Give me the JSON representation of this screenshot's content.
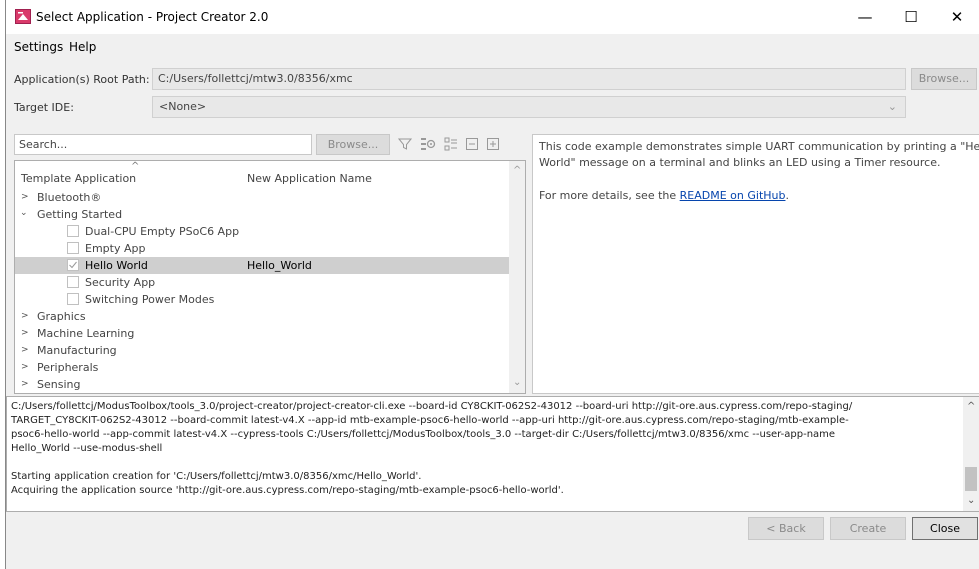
{
  "window": {
    "title": "Select Application - Project Creator 2.0"
  },
  "window_controls": {
    "minimize": "—",
    "maximize": "☐",
    "close": "✕"
  },
  "menu": {
    "settings": "Settings",
    "help": "Help"
  },
  "root_path": {
    "label": "Application(s) Root Path:",
    "value": "C:/Users/follettcj/mtw3.0/8356/xmc",
    "browse": "Browse..."
  },
  "target_ide": {
    "label": "Target IDE:",
    "value": "<None>"
  },
  "search": {
    "placeholder": "Search...",
    "browse": "Browse..."
  },
  "tree": {
    "col_template": "Template Application",
    "col_name": "New Application Name",
    "items": [
      {
        "label": "Bluetooth®",
        "name": ""
      },
      {
        "label": "Getting Started",
        "name": ""
      },
      {
        "label": "Dual-CPU Empty PSoC6 App",
        "name": ""
      },
      {
        "label": "Empty App",
        "name": ""
      },
      {
        "label": "Hello World",
        "name": "Hello_World"
      },
      {
        "label": "Security App",
        "name": ""
      },
      {
        "label": "Switching Power Modes",
        "name": ""
      },
      {
        "label": "Graphics",
        "name": ""
      },
      {
        "label": "Machine Learning",
        "name": ""
      },
      {
        "label": "Manufacturing",
        "name": ""
      },
      {
        "label": "Peripherals",
        "name": ""
      },
      {
        "label": "Sensing",
        "name": ""
      }
    ]
  },
  "description": {
    "line1": "This code example demonstrates simple UART communication by printing a \"Hello",
    "line2": "World\" message on a terminal and blinks an LED using a Timer resource.",
    "details_prefix": "For more details, see the ",
    "details_link": "README on GitHub",
    "details_suffix": "."
  },
  "console": {
    "lines": [
      "C:/Users/follettcj/ModusToolbox/tools_3.0/project-creator/project-creator-cli.exe --board-id CY8CKIT-062S2-43012 --board-uri http://git-ore.aus.cypress.com/repo-staging/",
      "TARGET_CY8CKIT-062S2-43012 --board-commit latest-v4.X --app-id mtb-example-psoc6-hello-world --app-uri http://git-ore.aus.cypress.com/repo-staging/mtb-example-",
      "psoc6-hello-world --app-commit latest-v4.X --cypress-tools C:/Users/follettcj/ModusToolbox/tools_3.0 --target-dir C:/Users/follettcj/mtw3.0/8356/xmc --user-app-name",
      "Hello_World --use-modus-shell",
      "",
      "Starting application creation for 'C:/Users/follettcj/mtw3.0/8356/xmc/Hello_World'.",
      "Acquiring the application source 'http://git-ore.aus.cypress.com/repo-staging/mtb-example-psoc6-hello-world'."
    ]
  },
  "buttons": {
    "back": "< Back",
    "create": "Create",
    "close": "Close"
  },
  "colors": {
    "accent": "#0645ad",
    "selected_row": "#cfcfcf",
    "window_bg": "#f0f0f0"
  }
}
